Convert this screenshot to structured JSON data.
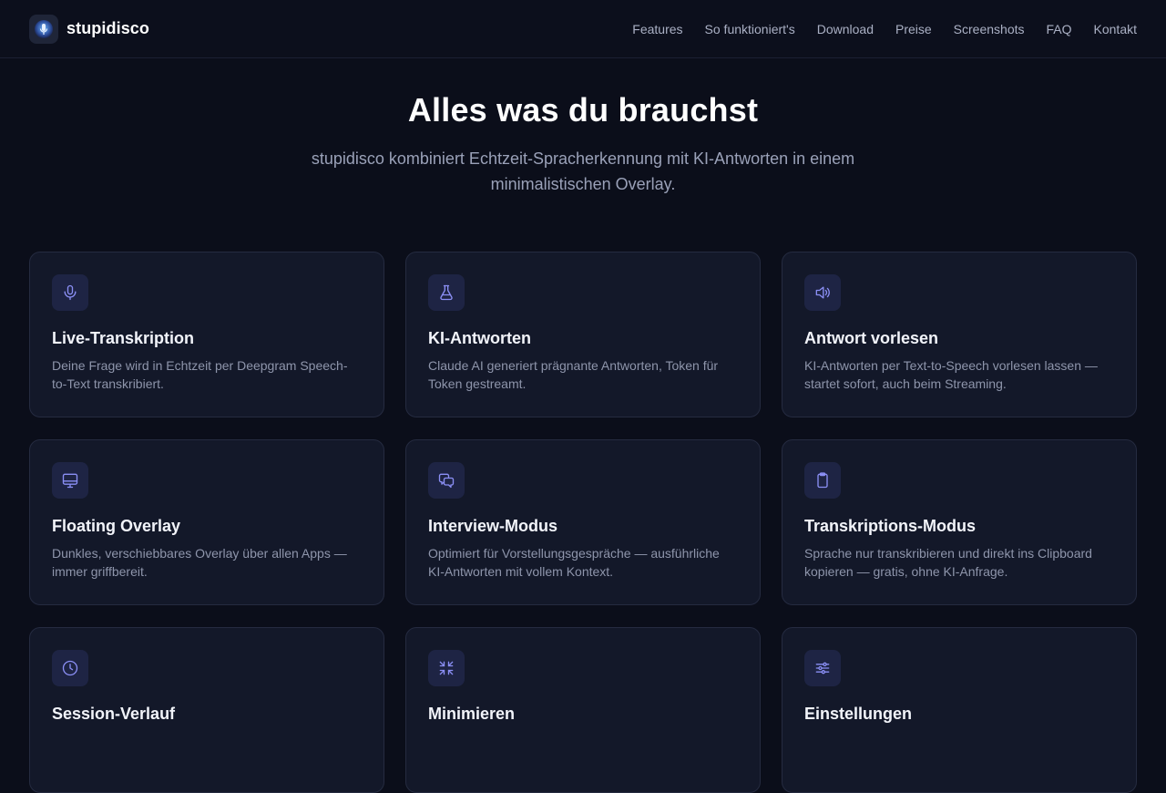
{
  "brand": {
    "name": "stupidisco",
    "logo_icon": "mic-orb-icon"
  },
  "nav": {
    "links": [
      "Features",
      "So funktioniert's",
      "Download",
      "Preise",
      "Screenshots",
      "FAQ",
      "Kontakt"
    ]
  },
  "hero": {
    "title": "Alles was du brauchst",
    "subtitle": "stupidisco kombiniert Echtzeit-Spracherkennung mit KI-Antworten in einem minimalistischen Overlay."
  },
  "features": [
    {
      "icon": "microphone-icon",
      "title": "Live-Transkription",
      "desc": "Deine Frage wird in Echtzeit per Deepgram Speech-to-Text transkribiert."
    },
    {
      "icon": "flask-icon",
      "title": "KI-Antworten",
      "desc": "Claude AI generiert prägnante Antworten, Token für Token gestreamt."
    },
    {
      "icon": "speaker-icon",
      "title": "Antwort vorlesen",
      "desc": "KI-Antworten per Text-to-Speech vorlesen lassen — startet sofort, auch beim Streaming."
    },
    {
      "icon": "monitor-icon",
      "title": "Floating Overlay",
      "desc": "Dunkles, verschiebbares Overlay über allen Apps — immer griffbereit."
    },
    {
      "icon": "chat-bubbles-icon",
      "title": "Interview-Modus",
      "desc": "Optimiert für Vorstellungsgespräche — ausführliche KI-Antworten mit vollem Kontext."
    },
    {
      "icon": "clipboard-icon",
      "title": "Transkriptions-Modus",
      "desc": "Sprache nur transkribieren und direkt ins Clipboard kopieren — gratis, ohne KI-Anfrage."
    },
    {
      "icon": "clock-icon",
      "title": "Session-Verlauf",
      "desc": ""
    },
    {
      "icon": "minimize-icon",
      "title": "Minimieren",
      "desc": ""
    },
    {
      "icon": "sliders-icon",
      "title": "Einstellungen",
      "desc": ""
    }
  ],
  "colors": {
    "background": "#0b0e1a",
    "card": "#131829",
    "accent": "#8b8ff5"
  }
}
